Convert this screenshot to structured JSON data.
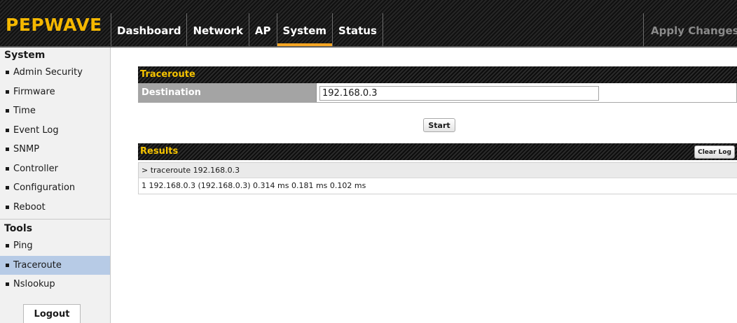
{
  "header": {
    "logo": "PEPWAVE",
    "tabs": [
      {
        "label": "Dashboard"
      },
      {
        "label": "Network"
      },
      {
        "label": "AP"
      },
      {
        "label": "System"
      },
      {
        "label": "Status"
      }
    ],
    "active_tab": "System",
    "apply_label": "Apply Changes",
    "accent_color": "#f5a623",
    "logo_color": "#f5b800"
  },
  "sidebar": {
    "system_heading": "System",
    "system_items": [
      {
        "label": "Admin Security"
      },
      {
        "label": "Firmware"
      },
      {
        "label": "Time"
      },
      {
        "label": "Event Log"
      },
      {
        "label": "SNMP"
      },
      {
        "label": "Controller"
      },
      {
        "label": "Configuration"
      },
      {
        "label": "Reboot"
      }
    ],
    "tools_heading": "Tools",
    "tools_items": [
      {
        "label": "Ping"
      },
      {
        "label": "Traceroute"
      },
      {
        "label": "Nslookup"
      }
    ],
    "active_item": "Traceroute",
    "logout_label": "Logout"
  },
  "traceroute": {
    "title": "Traceroute",
    "destination_label": "Destination",
    "destination_value": "192.168.0.3",
    "start_label": "Start"
  },
  "results": {
    "title": "Results",
    "clear_label": "Clear Log",
    "lines": [
      "> traceroute 192.168.0.3",
      "1 192.168.0.3 (192.168.0.3) 0.314 ms 0.181 ms 0.102 ms"
    ]
  }
}
